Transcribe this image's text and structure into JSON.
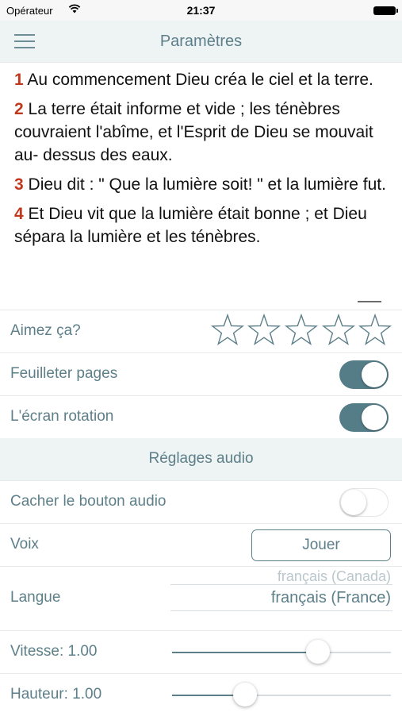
{
  "status_bar": {
    "carrier": "Opérateur",
    "time": "21:37"
  },
  "nav": {
    "title": "Paramètres"
  },
  "verses": [
    {
      "num": "1",
      "text": "Au commencement Dieu créa le ciel et la terre."
    },
    {
      "num": "2",
      "text": "La terre était informe et vide ; les ténèbres couvraient l'abîme, et l'Esprit de Dieu se mouvait au- dessus des eaux."
    },
    {
      "num": "3",
      "text": "Dieu dit : \" Que la lumière soit! \" et la lumière fut."
    },
    {
      "num": "4",
      "text": "Et Dieu vit que la lumière était bonne ; et Dieu sépara la lumière et les ténèbres."
    }
  ],
  "settings": {
    "rating": {
      "label": "Aimez ça?",
      "stars_total": 5,
      "stars_filled": 0
    },
    "page_flip": {
      "label": "Feuilleter pages",
      "on": true
    },
    "screen_rotation": {
      "label": "L'écran rotation",
      "on": true
    }
  },
  "audio": {
    "header": "Réglages audio",
    "hide_audio_button": {
      "label": "Cacher le bouton audio",
      "on": false
    },
    "voice": {
      "label": "Voix",
      "button": "Jouer"
    },
    "language": {
      "label": "Langue",
      "option_prev": "français (Canada)",
      "option_selected": "français (France)"
    },
    "speed": {
      "label": "Vitesse: 1.00",
      "value": 1.0,
      "min": 0.0,
      "max": 1.5
    },
    "pitch": {
      "label": "Hauteur: 1.00",
      "value": 1.0,
      "min": 0.0,
      "max": 3.0
    }
  },
  "colors": {
    "accent": "#557d88",
    "verse_number": "#c0391d",
    "header_bg": "#eef3f4"
  }
}
